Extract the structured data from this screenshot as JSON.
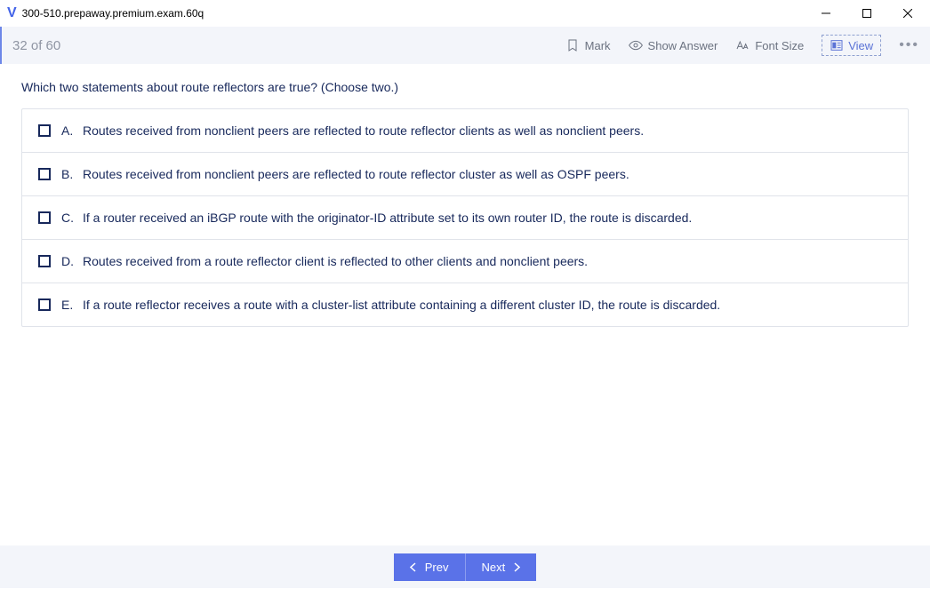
{
  "window": {
    "title": "300-510.prepaway.premium.exam.60q"
  },
  "toolbar": {
    "progress": "32 of 60",
    "mark_label": "Mark",
    "show_answer_label": "Show Answer",
    "font_size_label": "Font Size",
    "view_label": "View"
  },
  "question": {
    "text": "Which two statements about route reflectors are true? (Choose two.)",
    "options": [
      {
        "letter": "A.",
        "text": "Routes received from nonclient peers are reflected to route reflector clients as well as nonclient peers."
      },
      {
        "letter": "B.",
        "text": "Routes received from nonclient peers are reflected to route reflector cluster as well as OSPF peers."
      },
      {
        "letter": "C.",
        "text": "If a router received an iBGP route with the originator-ID attribute set to its own router ID, the route is discarded."
      },
      {
        "letter": "D.",
        "text": "Routes received from a route reflector client is reflected to other clients and nonclient peers."
      },
      {
        "letter": "E.",
        "text": "If a route reflector receives a route with a cluster-list attribute containing a different cluster ID, the route is discarded."
      }
    ]
  },
  "nav": {
    "prev_label": "Prev",
    "next_label": "Next"
  }
}
